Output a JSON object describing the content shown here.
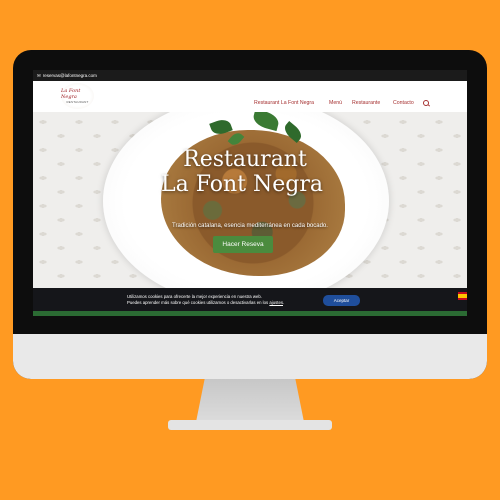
{
  "topbar": {
    "email": "reservas@lafontnegra.com"
  },
  "logo": {
    "title": "La Font Negra",
    "subtitle": "RESTAURANT"
  },
  "nav": {
    "items": [
      {
        "label": "Restaurant La Font Negra"
      },
      {
        "label": "Menú"
      },
      {
        "label": "Restaurante"
      },
      {
        "label": "Contacto"
      }
    ]
  },
  "hero": {
    "title_line1": "Restaurant",
    "title_line2": "La Font Negra",
    "tagline": "Tradición catalana, esencia mediterránea en cada bocado.",
    "cta_label": "Hacer Reseva"
  },
  "cookie": {
    "line1": "Utilizamos cookies para ofrecerte la mejor experiencia en nuestra web.",
    "line2_prefix": "Puedes aprender más sobre qué cookies utilizamos o desactivarlas en los",
    "line2_link": "ajustes",
    "accept_label": "Aceptar"
  },
  "colors": {
    "background": "#FF9A22",
    "accent": "#A52F2F",
    "cta": "#4B8B3E",
    "accept": "#1F4E9B"
  }
}
